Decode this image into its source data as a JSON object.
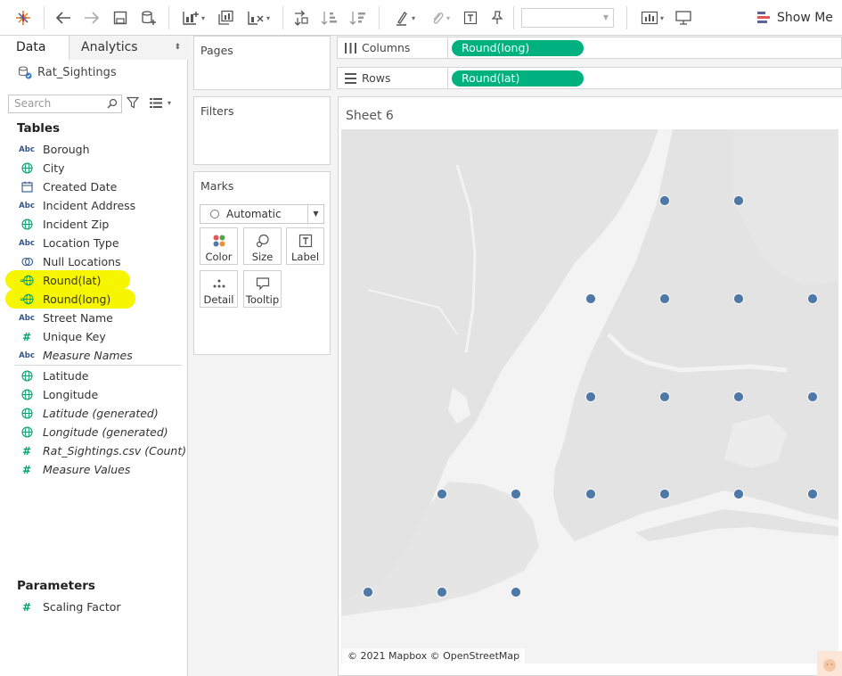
{
  "toolbar": {
    "icons": [
      "tableau-logo-icon",
      "back-icon",
      "forward-icon",
      "save-icon",
      "new-datasource-icon",
      "new-worksheet-icon",
      "duplicate-icon",
      "clear-sheet-icon",
      "swap-icon",
      "sort-ascending-icon",
      "sort-descending-icon",
      "highlight-icon",
      "paperclip-icon",
      "text-label-icon",
      "pin-icon",
      "bar-chart-icon",
      "presentation-icon"
    ],
    "fit_select_value": "",
    "show_me_label": "Show Me"
  },
  "data_pane": {
    "tab_data": "Data",
    "tab_analytics": "Analytics",
    "tab_arrows": "⬍",
    "datasource": "Rat_Sightings",
    "search_placeholder": "Search",
    "tables_title": "Tables",
    "dimensions": [
      {
        "type": "Abc",
        "icon": "string-icon",
        "label": "Borough",
        "italic": false
      },
      {
        "type": "geo",
        "icon": "globe-icon",
        "label": "City",
        "italic": false
      },
      {
        "type": "date",
        "icon": "calendar-icon",
        "label": "Created Date",
        "italic": false
      },
      {
        "type": "Abc",
        "icon": "string-icon",
        "label": "Incident Address",
        "italic": false
      },
      {
        "type": "geo",
        "icon": "globe-icon",
        "label": "Incident Zip",
        "italic": false
      },
      {
        "type": "Abc",
        "icon": "string-icon",
        "label": "Location Type",
        "italic": false
      },
      {
        "type": "null",
        "icon": "null-locations-icon",
        "label": "Null Locations",
        "italic": false
      },
      {
        "type": "calcgeo",
        "icon": "calc-globe-icon",
        "label": "Round(lat)",
        "italic": false,
        "highlighted": true
      },
      {
        "type": "calcgeo",
        "icon": "calc-globe-icon",
        "label": "Round(long)",
        "italic": false,
        "highlighted": true
      },
      {
        "type": "Abc",
        "icon": "string-icon",
        "label": "Street Name",
        "italic": false
      },
      {
        "type": "num",
        "icon": "number-icon",
        "label": "Unique Key",
        "italic": false
      },
      {
        "type": "Abc",
        "icon": "string-icon",
        "label": "Measure Names",
        "italic": true
      }
    ],
    "measures": [
      {
        "type": "geo",
        "icon": "globe-icon",
        "label": "Latitude",
        "italic": false
      },
      {
        "type": "geo",
        "icon": "globe-icon",
        "label": "Longitude",
        "italic": false
      },
      {
        "type": "geo",
        "icon": "globe-icon",
        "label": "Latitude (generated)",
        "italic": true
      },
      {
        "type": "geo",
        "icon": "globe-icon",
        "label": "Longitude (generated)",
        "italic": true
      },
      {
        "type": "num",
        "icon": "number-icon",
        "label": "Rat_Sightings.csv (Count)",
        "italic": true
      },
      {
        "type": "num",
        "icon": "number-icon",
        "label": "Measure Values",
        "italic": true
      }
    ],
    "parameters_title": "Parameters",
    "parameters": [
      {
        "type": "num",
        "icon": "number-icon",
        "label": "Scaling Factor",
        "italic": false
      }
    ]
  },
  "cards": {
    "pages_title": "Pages",
    "filters_title": "Filters",
    "marks_title": "Marks",
    "mark_type": "Automatic",
    "mark_buttons": [
      {
        "label": "Color",
        "icon": "color-icon"
      },
      {
        "label": "Size",
        "icon": "size-icon"
      },
      {
        "label": "Label",
        "icon": "label-icon"
      },
      {
        "label": "Detail",
        "icon": "detail-icon"
      },
      {
        "label": "Tooltip",
        "icon": "tooltip-icon"
      }
    ]
  },
  "shelves": {
    "columns_label": "Columns",
    "columns_pill": "Round(long)",
    "rows_label": "Rows",
    "rows_pill": "Round(lat)"
  },
  "view": {
    "sheet_title": "Sheet 6",
    "map_credit": "© 2021 Mapbox © OpenStreetMap",
    "mark_color": "#4e79a7",
    "pill_color": "#00b180",
    "highlight_color": "#f6f600",
    "marks_count": 20
  }
}
